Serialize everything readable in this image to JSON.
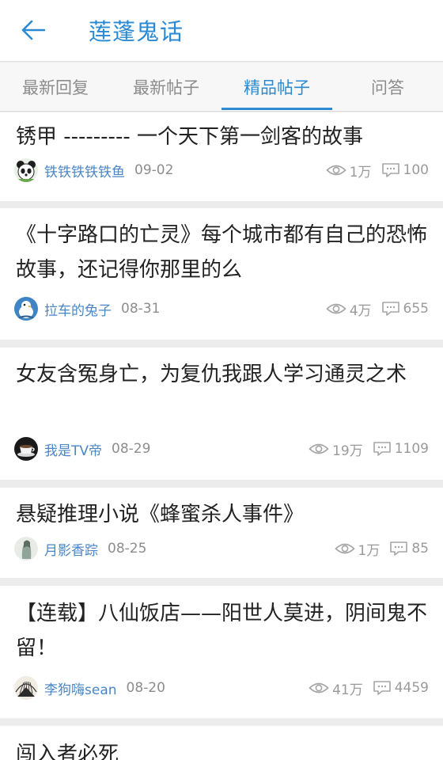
{
  "header": {
    "title": "莲蓬鬼话",
    "back_icon": "arrow-left-icon"
  },
  "tabs": [
    {
      "label": "最新回复",
      "active": false
    },
    {
      "label": "最新帖子",
      "active": false
    },
    {
      "label": "精品帖子",
      "active": true
    },
    {
      "label": "问答",
      "active": false
    }
  ],
  "colors": {
    "accent": "#2b8ad1",
    "author": "#4a86c4",
    "muted": "#9a9a9a"
  },
  "posts": [
    {
      "title": "锈甲 --------- 一个天下第一剑客的故事",
      "author": "铁铁铁铁铁鱼",
      "date": "09-02",
      "views": "1万",
      "comments": "100",
      "avatar_icon": "panda-avatar"
    },
    {
      "title": "《十字路口的亡灵》每个城市都有自己的恐怖故事，还记得你那里的么",
      "author": "拉车的兔子",
      "date": "08-31",
      "views": "4万",
      "comments": "655",
      "avatar_icon": "bird-avatar"
    },
    {
      "title": "女友含冤身亡，为复仇我跟人学习通灵之术",
      "author": "我是TV帝",
      "date": "08-29",
      "views": "19万",
      "comments": "1109",
      "avatar_icon": "cup-avatar"
    },
    {
      "title": "悬疑推理小说《蜂蜜杀人事件》",
      "author": "月影香踪",
      "date": "08-25",
      "views": "1万",
      "comments": "85",
      "avatar_icon": "figure-avatar"
    },
    {
      "title": "【连载】八仙饭店——阳世人莫进，阴间鬼不留！",
      "author": "李狗嗨sean",
      "date": "08-20",
      "views": "41万",
      "comments": "4459",
      "avatar_icon": "fan-avatar"
    },
    {
      "title": "闯入者必死"
    }
  ]
}
